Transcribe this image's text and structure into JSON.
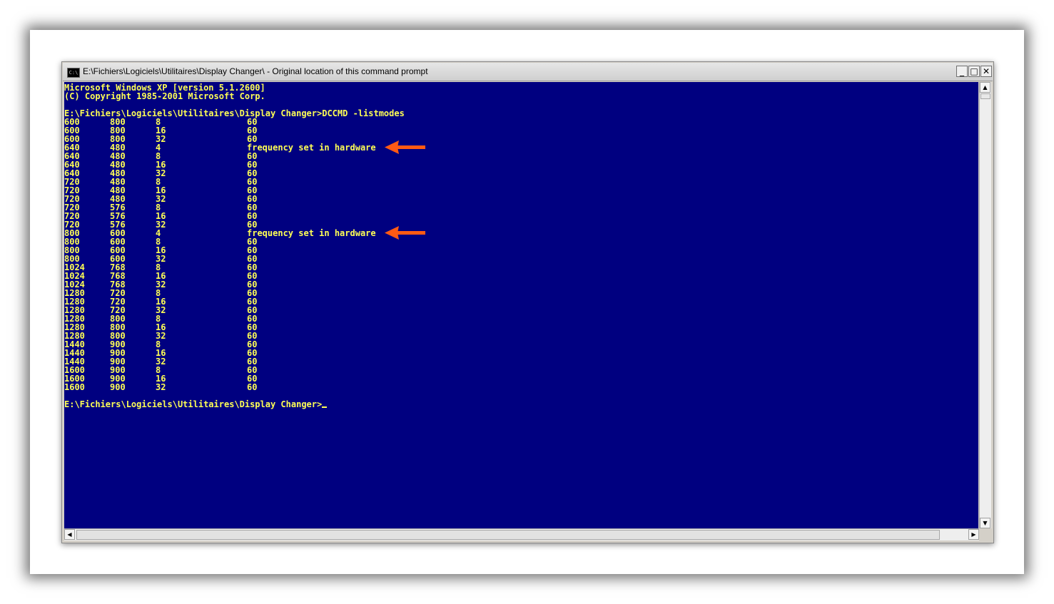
{
  "window": {
    "title": "E:\\Fichiers\\Logiciels\\Utilitaires\\Display Changer\\ - Original location of this command prompt",
    "icon": "C:\\",
    "buttons": {
      "minimize": "_",
      "maximize": "□",
      "close": "✕"
    }
  },
  "console": {
    "header": [
      "Microsoft Windows XP [version 5.1.2600]",
      "(C) Copyright 1985-2001 Microsoft Corp."
    ],
    "command_line": "E:\\Fichiers\\Logiciels\\Utilitaires\\Display Changer>DCCMD -listmodes",
    "modes": [
      [
        "600",
        "800",
        "8",
        "60"
      ],
      [
        "600",
        "800",
        "16",
        "60"
      ],
      [
        "600",
        "800",
        "32",
        "60"
      ],
      [
        "640",
        "480",
        "4",
        "frequency set in hardware"
      ],
      [
        "640",
        "480",
        "8",
        "60"
      ],
      [
        "640",
        "480",
        "16",
        "60"
      ],
      [
        "640",
        "480",
        "32",
        "60"
      ],
      [
        "720",
        "480",
        "8",
        "60"
      ],
      [
        "720",
        "480",
        "16",
        "60"
      ],
      [
        "720",
        "480",
        "32",
        "60"
      ],
      [
        "720",
        "576",
        "8",
        "60"
      ],
      [
        "720",
        "576",
        "16",
        "60"
      ],
      [
        "720",
        "576",
        "32",
        "60"
      ],
      [
        "800",
        "600",
        "4",
        "frequency set in hardware"
      ],
      [
        "800",
        "600",
        "8",
        "60"
      ],
      [
        "800",
        "600",
        "16",
        "60"
      ],
      [
        "800",
        "600",
        "32",
        "60"
      ],
      [
        "1024",
        "768",
        "8",
        "60"
      ],
      [
        "1024",
        "768",
        "16",
        "60"
      ],
      [
        "1024",
        "768",
        "32",
        "60"
      ],
      [
        "1280",
        "720",
        "8",
        "60"
      ],
      [
        "1280",
        "720",
        "16",
        "60"
      ],
      [
        "1280",
        "720",
        "32",
        "60"
      ],
      [
        "1280",
        "800",
        "8",
        "60"
      ],
      [
        "1280",
        "800",
        "16",
        "60"
      ],
      [
        "1280",
        "800",
        "32",
        "60"
      ],
      [
        "1440",
        "900",
        "8",
        "60"
      ],
      [
        "1440",
        "900",
        "16",
        "60"
      ],
      [
        "1440",
        "900",
        "32",
        "60"
      ],
      [
        "1600",
        "900",
        "8",
        "60"
      ],
      [
        "1600",
        "900",
        "16",
        "60"
      ],
      [
        "1600",
        "900",
        "32",
        "60"
      ]
    ],
    "prompt": "E:\\Fichiers\\Logiciels\\Utilitaires\\Display Changer>",
    "highlighted_rows": [
      3,
      13
    ]
  },
  "colors": {
    "console_background": "#000080",
    "console_text": "#ffff55",
    "annotation_arrow": "#ff5a14"
  }
}
